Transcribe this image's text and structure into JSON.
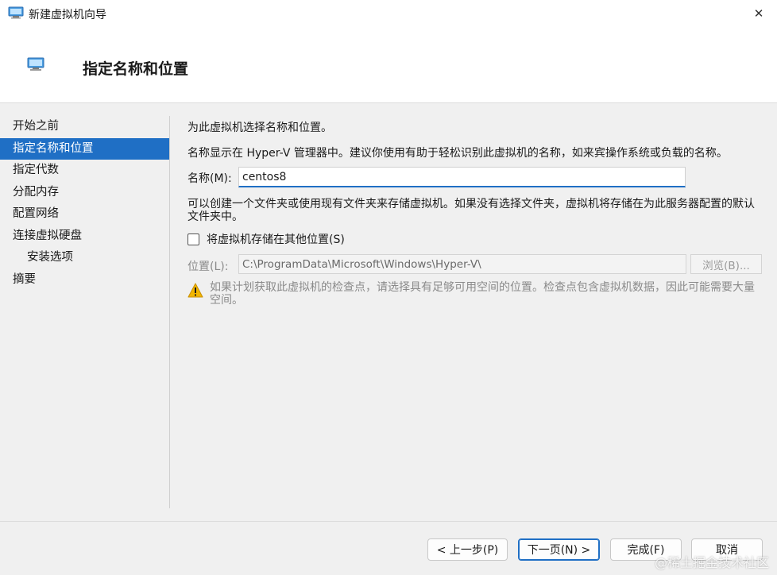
{
  "window": {
    "title": "新建虚拟机向导",
    "close_glyph": "✕"
  },
  "header": {
    "title": "指定名称和位置"
  },
  "nav": {
    "items": [
      {
        "label": "开始之前"
      },
      {
        "label": "指定名称和位置"
      },
      {
        "label": "指定代数"
      },
      {
        "label": "分配内存"
      },
      {
        "label": "配置网络"
      },
      {
        "label": "连接虚拟硬盘"
      },
      {
        "label": "安装选项"
      },
      {
        "label": "摘要"
      }
    ]
  },
  "content": {
    "intro": "为此虚拟机选择名称和位置。",
    "description": "名称显示在 Hyper-V 管理器中。建议你使用有助于轻松识别此虚拟机的名称，如来宾操作系统或负载的名称。",
    "name_label": "名称(M):",
    "name_value": "centos8",
    "folder_text": "可以创建一个文件夹或使用现有文件夹来存储虚拟机。如果没有选择文件夹，虚拟机将存储在为此服务器配置的默认文件夹中。",
    "checkbox_label": "将虚拟机存储在其他位置(S)",
    "checkbox_checked": false,
    "location_label": "位置(L):",
    "location_value": "C:\\ProgramData\\Microsoft\\Windows\\Hyper-V\\",
    "browse_label": "浏览(B)...",
    "warning_text": "如果计划获取此虚拟机的检查点，请选择具有足够可用空间的位置。检查点包含虚拟机数据，因此可能需要大量空间。"
  },
  "footer": {
    "prev_label": "< 上一步(P)",
    "next_label": "下一页(N) >",
    "finish_label": "完成(F)",
    "cancel_label": "取消"
  },
  "watermark": "@稀土掘金技术社区",
  "colors": {
    "accent": "#1f6fc5",
    "warning": "#e8a600"
  }
}
